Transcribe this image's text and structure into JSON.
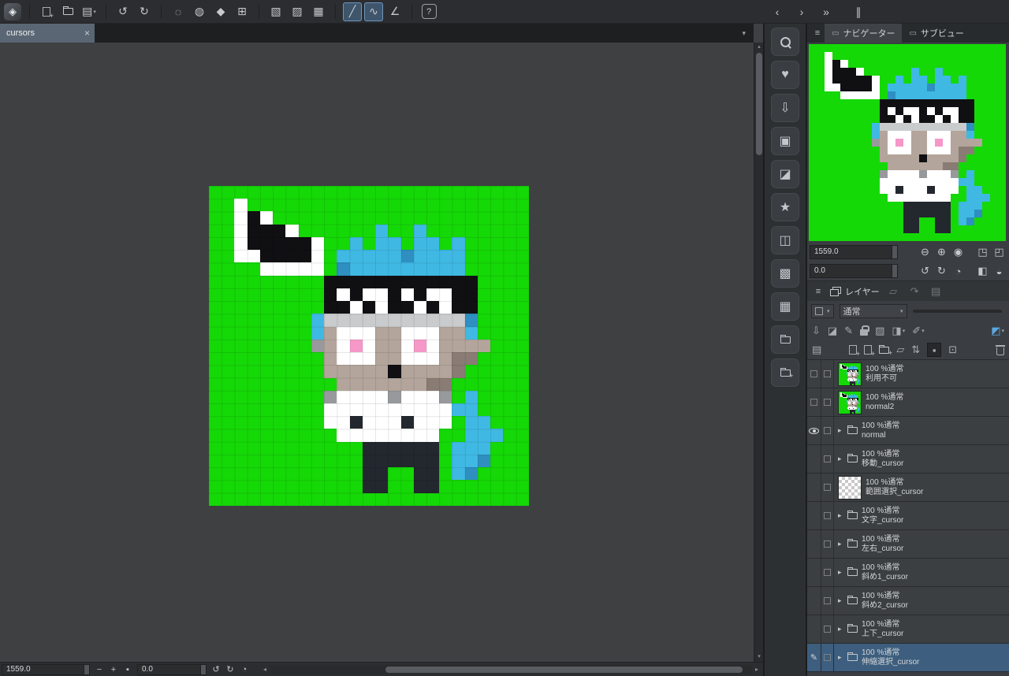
{
  "colors": {
    "canvas_green": "#15d807",
    "selection_blue": "#3d5e7e",
    "tool_highlight_blue": "#3e556c",
    "panel_bg": "#3a3d41",
    "toolbar_bg": "#2b2d30"
  },
  "glyphs": {
    "dropdown": "▾"
  },
  "scrollbars": {
    "up": "▴",
    "down": "▾",
    "left": "◂",
    "right": "▸"
  },
  "document_tab": {
    "label": "cursors",
    "close_glyph": "×",
    "list_chevron": "▾"
  },
  "top_toolbar": {
    "groups": [
      [
        {
          "name": "app-logo-icon",
          "glyph": "◈",
          "cls": "i-logo",
          "interactable": false
        }
      ],
      [
        {
          "name": "new-file-button",
          "cls": "i-page-plus"
        },
        {
          "name": "open-file-button",
          "cls": "i-folder"
        },
        {
          "name": "export-print-button",
          "glyph": "▤",
          "dropdown": true
        }
      ],
      [
        {
          "name": "undo-button",
          "glyph": "↺"
        },
        {
          "name": "redo-button",
          "glyph": "↻"
        }
      ],
      [
        {
          "name": "deselect-button",
          "glyph": "◌"
        },
        {
          "name": "invert-selection-button",
          "glyph": "◍"
        },
        {
          "name": "fill-tool-button",
          "glyph": "◆"
        },
        {
          "name": "crop-frame-button",
          "glyph": "⊞"
        }
      ],
      [
        {
          "name": "rect-select-button",
          "glyph": "▧"
        },
        {
          "name": "lasso-select-button",
          "glyph": "▨"
        },
        {
          "name": "grid-select-button",
          "glyph": "▦"
        }
      ],
      [
        {
          "name": "line-tool-button",
          "glyph": "╱",
          "active": true
        },
        {
          "name": "curve-tool-button",
          "glyph": "∿",
          "active": true
        },
        {
          "name": "angle-tool-button",
          "glyph": "∠"
        }
      ],
      [
        {
          "name": "help-button",
          "glyph": "?",
          "cls": "i-help"
        }
      ]
    ],
    "dock_controls": [
      {
        "name": "collapse-dock-icon",
        "glyph": "‹"
      },
      {
        "name": "expand-dock-icon",
        "glyph": "›"
      },
      {
        "name": "expand-all-dock-icon",
        "glyph": "»"
      },
      {
        "name": "dock-handle-icon",
        "glyph": "∥",
        "gap_before": true
      }
    ]
  },
  "right_strip": {
    "icons": [
      {
        "name": "quick-access-search-icon",
        "cls": "i-search"
      },
      {
        "name": "favorites-heart-icon",
        "glyph": "♥"
      },
      {
        "name": "download-materials-icon",
        "glyph": "⇩"
      },
      {
        "name": "material-box-icon",
        "glyph": "▣"
      },
      {
        "name": "material-illustration-icon",
        "glyph": "◪"
      },
      {
        "name": "material-star-icon",
        "glyph": "★"
      },
      {
        "name": "material-image-icon",
        "glyph": "◫"
      },
      {
        "name": "material-pattern-icon",
        "glyph": "▩"
      },
      {
        "name": "material-grid-icon",
        "glyph": "▦"
      },
      {
        "name": "material-folder-icon",
        "cls": "i-folder"
      },
      {
        "name": "material-folder-settings-icon",
        "cls": "i-folder-plus"
      }
    ]
  },
  "navigator": {
    "menu_glyph": "≡",
    "tabs": [
      {
        "label": "ナビゲーター",
        "icon": "▭",
        "active": true
      },
      {
        "label": "サブビュー",
        "icon": "▭",
        "active": false
      }
    ],
    "zoom": {
      "value": "1559.0",
      "icons": [
        {
          "name": "zoom-out-icon",
          "glyph": "⊖"
        },
        {
          "name": "zoom-in-icon",
          "glyph": "⊕"
        },
        {
          "name": "zoom-100-icon",
          "glyph": "◉"
        },
        {
          "name": "fit-to-window-icon",
          "glyph": "◳",
          "gap_before": true
        },
        {
          "name": "fit-to-screen-icon",
          "glyph": "◰"
        }
      ]
    },
    "rotation": {
      "value": "0.0",
      "icons": [
        {
          "name": "rotate-left-icon",
          "glyph": "↺"
        },
        {
          "name": "rotate-right-icon",
          "glyph": "↻"
        },
        {
          "name": "reset-rotation-icon",
          "glyph": "◔"
        },
        {
          "name": "flip-horizontal-icon",
          "glyph": "◧",
          "gap_before": true
        },
        {
          "name": "flip-vertical-icon",
          "glyph": "◒"
        }
      ]
    }
  },
  "layer_panel": {
    "menu_glyph": "≡",
    "title": "レイヤー",
    "expand_glyph": "▸",
    "pencil_glyph": "✎",
    "header_icons": [
      {
        "name": "layer-search-icon",
        "glyph": "▱",
        "disabled": true
      },
      {
        "name": "layer-revert-icon",
        "glyph": "↷",
        "disabled": true
      },
      {
        "name": "layer-grid-icon",
        "glyph": "▤",
        "disabled": true
      }
    ],
    "blend_mode": "通常",
    "tools_row1": [
      {
        "name": "transfer-down-icon",
        "glyph": "⇩"
      },
      {
        "name": "clipping-mask-icon",
        "glyph": "◪"
      },
      {
        "name": "draft-layer-icon",
        "glyph": "✎"
      },
      {
        "name": "lock-layer-icon",
        "cls": "i-lock"
      },
      {
        "name": "lock-transparent-pixels-icon",
        "glyph": "▨"
      },
      {
        "name": "enable-mask-icon",
        "glyph": "◨",
        "dropdown": true
      },
      {
        "name": "ruler-icon",
        "glyph": "✐",
        "dropdown": true
      },
      {
        "name": "layer-color-icon",
        "glyph": "◩",
        "dropdown": true,
        "accent": true,
        "push_right": true
      }
    ],
    "tools_row2": [
      {
        "name": "layer-list-view-icon",
        "glyph": "▤",
        "gap_after": true
      },
      {
        "name": "new-layer-icon",
        "cls": "i-page-plus"
      },
      {
        "name": "new-layer-settings-icon",
        "cls": "i-page-plus"
      },
      {
        "name": "new-folder-icon",
        "cls": "i-folder-plus"
      },
      {
        "name": "duplicate-layer-icon",
        "glyph": "▱"
      },
      {
        "name": "transfer-layer-icon",
        "glyph": "⇅"
      },
      {
        "name": "paper-layer-icon",
        "glyph": "▪",
        "boxed": true
      },
      {
        "name": "combine-layer-icon",
        "glyph": "⊡"
      },
      {
        "name": "delete-layer-icon",
        "cls": "i-trash",
        "push_right": true
      }
    ],
    "layers": [
      {
        "info": "100 %通常",
        "name": "利用不可",
        "thumb": "art",
        "left": "checkbox"
      },
      {
        "info": "100 %通常",
        "name": "normal2",
        "thumb": "art",
        "left": "checkbox"
      },
      {
        "info": "100 %通常",
        "name": "normal",
        "thumb": "folder",
        "left": "eye"
      },
      {
        "info": "100 %通常",
        "name": "移動_cursor",
        "thumb": "folder",
        "left": "none"
      },
      {
        "info": "100 %通常",
        "name": "範囲選択_cursor",
        "thumb": "checker",
        "left": "none"
      },
      {
        "info": "100 %通常",
        "name": "文字_cursor",
        "thumb": "folder",
        "left": "none"
      },
      {
        "info": "100 %通常",
        "name": "左右_cursor",
        "thumb": "folder",
        "left": "none"
      },
      {
        "info": "100 %通常",
        "name": "斜め1_cursor",
        "thumb": "folder",
        "left": "none"
      },
      {
        "info": "100 %通常",
        "name": "斜め2_cursor",
        "thumb": "folder",
        "left": "none"
      },
      {
        "info": "100 %通常",
        "name": "上下_cursor",
        "thumb": "folder",
        "left": "none"
      },
      {
        "info": "100 %通常",
        "name": "伸縮選択_cursor",
        "thumb": "folder",
        "left": "pencil",
        "selected": true
      }
    ]
  },
  "status_bar": {
    "zoom_value": "1559.0",
    "zoom_icons": [
      {
        "name": "zoom-out-button",
        "glyph": "−"
      },
      {
        "name": "zoom-in-button",
        "glyph": "+"
      },
      {
        "name": "zoom-reset-button",
        "glyph": "▪"
      }
    ],
    "rotation_value": "0.0",
    "rotation_icons": [
      {
        "name": "rotate-left-button",
        "glyph": "↺"
      },
      {
        "name": "rotate-right-button",
        "glyph": "↻"
      },
      {
        "name": "reset-rotation-button",
        "glyph": "◔"
      }
    ]
  },
  "pixel_art": {
    "palette": {
      ".": "#15d807",
      "W": "#ffffff",
      "K": "#101013",
      "D": "#23272e",
      "T": "#b3a59b",
      "t": "#897c74",
      "B": "#3fb9e3",
      "b": "#2e8fc0",
      "P": "#f598c8",
      "G": "#c9cbcd",
      "g": "#97999c"
    },
    "rows": [
      ".........................",
      "..W......................",
      "..WKW....................",
      "..WKKKW......B..B........",
      "..WKKKKKW..B.BB.BB.B.....",
      "..WWKKKKW.BBBBBbBBBB.....",
      "....WWWWW.bBBBBBBBBB.....",
      ".........KKKKKKKKKKKK....",
      ".........KWKWWKWKWWKK....",
      ".........KKWKWKKWKWKK....",
      "........BGGGGGGGGGGGb....",
      "........BTWWWTTWWWTTB....",
      "........gTWPWTTWPWTTTT...",
      ".........TWWWTTWWWTtt....",
      ".........TTTTTKTTTTt.....",
      "..........TTTTTTTtt......",
      ".........gWWWWgWWWg.B....",
      ".........WWWWWWWWWWBB....",
      ".........WWDWWWDWWW.BB...",
      "..........WWWWWWWW..BBB..",
      "............DDDDDD.BBB...",
      "............DDDDDD.BBb...",
      "............DD..DD.Bb....",
      "............DD..DD.......",
      "........................."
    ]
  }
}
